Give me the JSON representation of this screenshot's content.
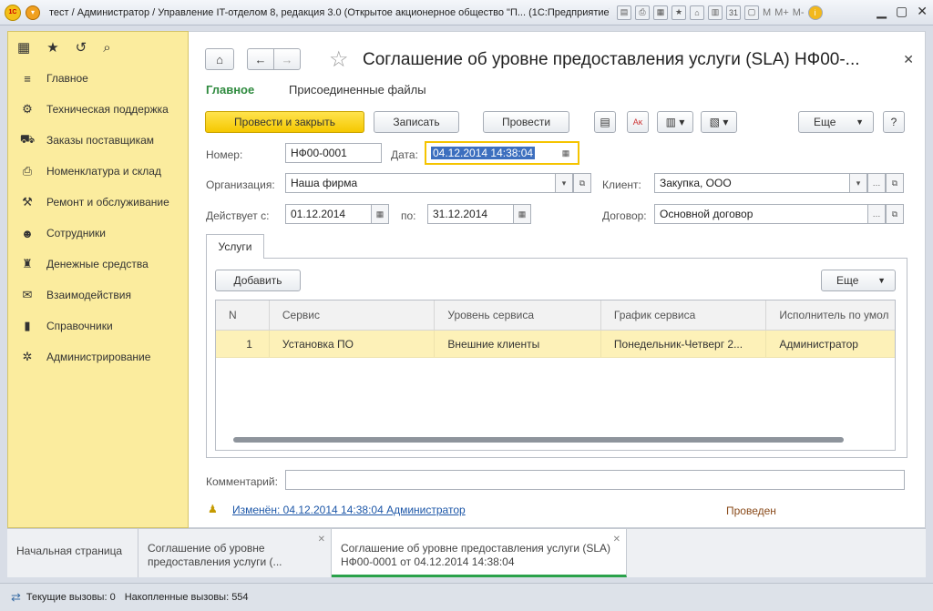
{
  "window": {
    "title": "тест / Администратор / Управление IT-отделом 8, редакция 3.0 (Открытое акционерное общество \"П... (1С:Предприятие)",
    "toolbar_m": "M",
    "toolbar_mplus": "M+",
    "toolbar_mminus": "M-"
  },
  "sidebar": {
    "items": [
      {
        "label": "Главное",
        "icon": "menu-lines-icon"
      },
      {
        "label": "Техническая поддержка",
        "icon": "support-icon"
      },
      {
        "label": "Заказы поставщикам",
        "icon": "truck-icon"
      },
      {
        "label": "Номенклатура и склад",
        "icon": "printer-icon"
      },
      {
        "label": "Ремонт и обслуживание",
        "icon": "tools-icon"
      },
      {
        "label": "Сотрудники",
        "icon": "people-icon"
      },
      {
        "label": "Денежные средства",
        "icon": "money-bag-icon"
      },
      {
        "label": "Взаимодействия",
        "icon": "envelope-icon"
      },
      {
        "label": "Справочники",
        "icon": "book-icon"
      },
      {
        "label": "Администрирование",
        "icon": "gear-icon"
      }
    ]
  },
  "form": {
    "title": "Соглашение об уровне предоставления услуги (SLA) НФ00-...",
    "tabs": {
      "main": "Главное",
      "files": "Присоединенные файлы"
    },
    "buttons": {
      "post_close": "Провести и закрыть",
      "save": "Записать",
      "post": "Провести",
      "more": "Еще",
      "help": "?"
    },
    "fields": {
      "number_label": "Номер:",
      "number_value": "НФ00-0001",
      "date_label": "Дата:",
      "date_value": "04.12.2014 14:38:04",
      "org_label": "Организация:",
      "org_value": "Наша фирма",
      "client_label": "Клиент:",
      "client_value": "Закупка, ООО",
      "valid_label": "Действует с:",
      "valid_from": "01.12.2014",
      "to_label": "по:",
      "valid_to": "31.12.2014",
      "contract_label": "Договор:",
      "contract_value": "Основной договор",
      "comment_label": "Комментарий:",
      "comment_value": ""
    },
    "services": {
      "tab_label": "Услуги",
      "add_button": "Добавить",
      "more_button": "Еще",
      "columns": [
        "N",
        "Сервис",
        "Уровень сервиса",
        "График сервиса",
        "Исполнитель по умол"
      ],
      "rows": [
        {
          "n": "1",
          "service": "Установка ПО",
          "level": "Внешние клиенты",
          "schedule": "Понедельник-Четверг 2...",
          "executor": "Администратор"
        }
      ]
    },
    "footer": {
      "changed": "Изменён: 04.12.2014 14:38:04 Администратор",
      "status": "Проведен"
    }
  },
  "bottom_tabs": [
    {
      "label": "Начальная страница"
    },
    {
      "label": "Соглашение об уровне предоставления услуги (..."
    },
    {
      "label": "Соглашение об уровне предоставления услуги (SLA) НФ00-0001 от 04.12.2014 14:38:04"
    }
  ],
  "statusbar": {
    "current_calls": "Текущие вызовы: 0",
    "accumulated_calls": "Накопленные вызовы: 554"
  },
  "colors": {
    "sidebar_bg": "#fbec9e",
    "primary_button": "#f5c800",
    "tab_green": "#2aa24a",
    "selected_row": "#fdf1b8",
    "status_brown": "#8a4b1b"
  }
}
